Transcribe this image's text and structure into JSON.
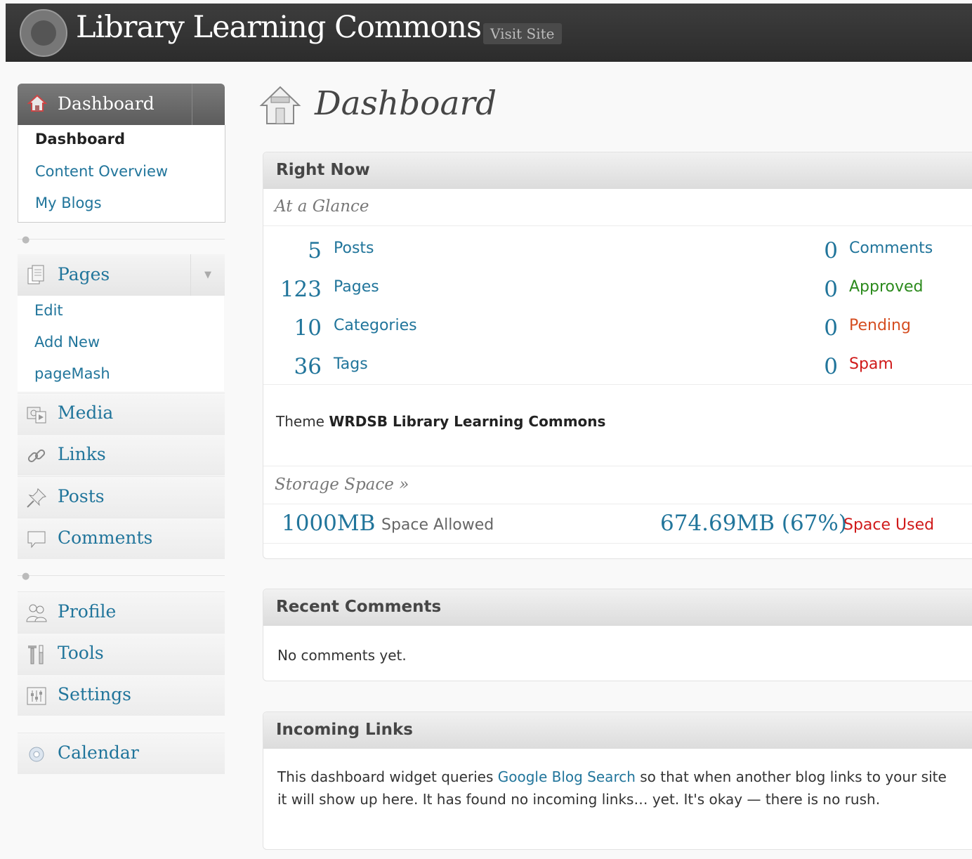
{
  "header": {
    "site_title": "Library Learning Commons",
    "visit_site": "Visit Site"
  },
  "sidebar": {
    "dashboard_menu": {
      "label": "Dashboard",
      "items": [
        "Dashboard",
        "Content Overview",
        "My Blogs"
      ]
    },
    "pages_menu": {
      "label": "Pages",
      "items": [
        "Edit",
        "Add New",
        "pageMash"
      ]
    },
    "menu_group1": [
      "Media",
      "Links",
      "Posts",
      "Comments"
    ],
    "menu_group2": [
      "Profile",
      "Tools",
      "Settings"
    ],
    "menu_group3": [
      "Calendar"
    ]
  },
  "main": {
    "page_title": "Dashboard",
    "right_now": {
      "title": "Right Now",
      "at_a_glance": "At a Glance",
      "content": [
        {
          "count": "5",
          "label": "Posts"
        },
        {
          "count": "123",
          "label": "Pages"
        },
        {
          "count": "10",
          "label": "Categories"
        },
        {
          "count": "36",
          "label": "Tags"
        }
      ],
      "discussion": [
        {
          "count": "0",
          "label": "Comments"
        },
        {
          "count": "0",
          "label": "Approved"
        },
        {
          "count": "0",
          "label": "Pending"
        },
        {
          "count": "0",
          "label": "Spam"
        }
      ],
      "theme_prefix": "Theme",
      "theme_name": "WRDSB Library Learning Commons",
      "storage_heading": "Storage Space »",
      "space_allowed_value": "1000MB",
      "space_allowed_label": "Space Allowed",
      "space_used_value": "674.69MB (67%)",
      "space_used_label": "Space Used"
    },
    "recent_comments": {
      "title": "Recent Comments",
      "text": "No comments yet."
    },
    "incoming_links": {
      "title": "Incoming Links",
      "text_before": "This dashboard widget queries",
      "link": "Google Blog Search",
      "text_after": "so that when another blog links to your site it will show up here. It has found no incoming links… yet. It's okay — there is no rush."
    }
  },
  "colors": {
    "link": "#21759b",
    "approved": "#2c8a1d",
    "pending": "#d54e21",
    "spam": "#d01a1a",
    "header_bg": "#333333"
  }
}
